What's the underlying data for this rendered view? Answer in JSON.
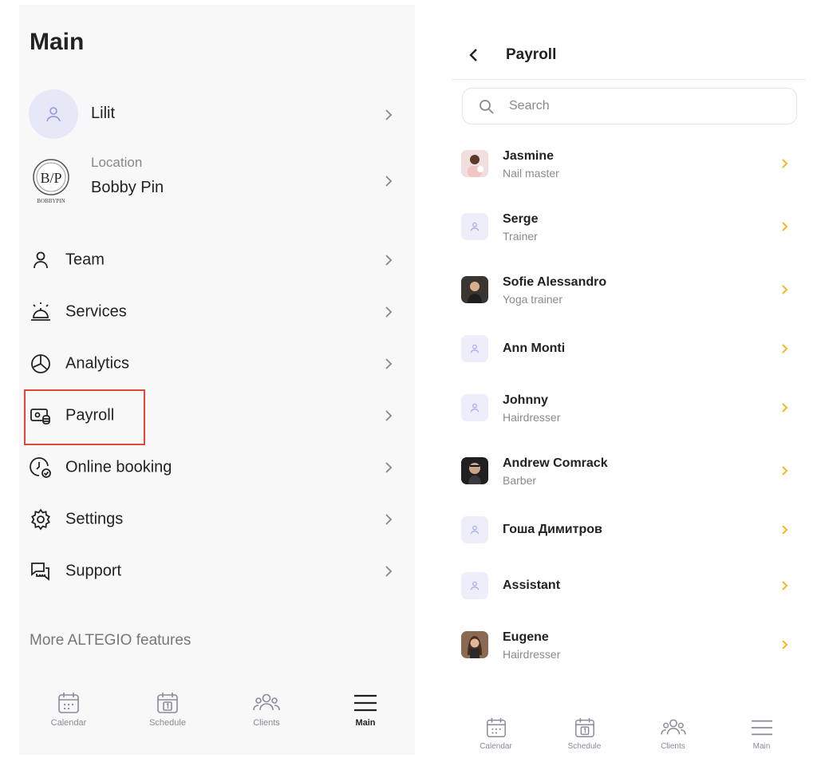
{
  "left": {
    "title": "Main",
    "profile": {
      "name": "Lilit"
    },
    "location": {
      "label": "Location",
      "name": "Bobby Pin",
      "logo_text": "B/P",
      "logo_subtext": "BOBBYPIN"
    },
    "menu": [
      {
        "label": "Team",
        "icon": "person-icon"
      },
      {
        "label": "Services",
        "icon": "service-bell-icon"
      },
      {
        "label": "Analytics",
        "icon": "pie-chart-icon"
      },
      {
        "label": "Payroll",
        "icon": "payroll-icon"
      },
      {
        "label": "Online booking",
        "icon": "clock-check-icon"
      },
      {
        "label": "Settings",
        "icon": "gear-icon"
      },
      {
        "label": "Support",
        "icon": "chat-icon"
      }
    ],
    "more_features": "More ALTEGIO features",
    "tabs": [
      {
        "label": "Calendar",
        "icon": "calendar-icon"
      },
      {
        "label": "Schedule",
        "icon": "schedule-icon",
        "day": "1"
      },
      {
        "label": "Clients",
        "icon": "clients-icon"
      },
      {
        "label": "Main",
        "icon": "menu-icon",
        "active": true
      }
    ]
  },
  "right": {
    "title": "Payroll",
    "search_placeholder": "Search",
    "staff": [
      {
        "name": "Jasmine",
        "role": "Nail master",
        "avatar": "photo"
      },
      {
        "name": "Serge",
        "role": "Trainer",
        "avatar": "placeholder"
      },
      {
        "name": "Sofie Alessandro",
        "role": "Yoga trainer",
        "avatar": "photo"
      },
      {
        "name": "Ann Monti",
        "role": "",
        "avatar": "placeholder"
      },
      {
        "name": "Johnny",
        "role": "Hairdresser",
        "avatar": "placeholder"
      },
      {
        "name": "Andrew Comrack",
        "role": "Barber",
        "avatar": "photo"
      },
      {
        "name": "Гоша Димитров",
        "role": "",
        "avatar": "placeholder"
      },
      {
        "name": "Assistant",
        "role": "",
        "avatar": "placeholder"
      },
      {
        "name": "Eugene",
        "role": "Hairdresser",
        "avatar": "photo"
      }
    ],
    "tabs": [
      {
        "label": "Calendar",
        "icon": "calendar-icon"
      },
      {
        "label": "Schedule",
        "icon": "schedule-icon",
        "day": "1"
      },
      {
        "label": "Clients",
        "icon": "clients-icon"
      },
      {
        "label": "Main",
        "icon": "menu-icon"
      }
    ]
  },
  "colors": {
    "highlight": "#e0483a",
    "chevron_accent": "#f2b824",
    "avatar_placeholder": "#eeeefa"
  }
}
